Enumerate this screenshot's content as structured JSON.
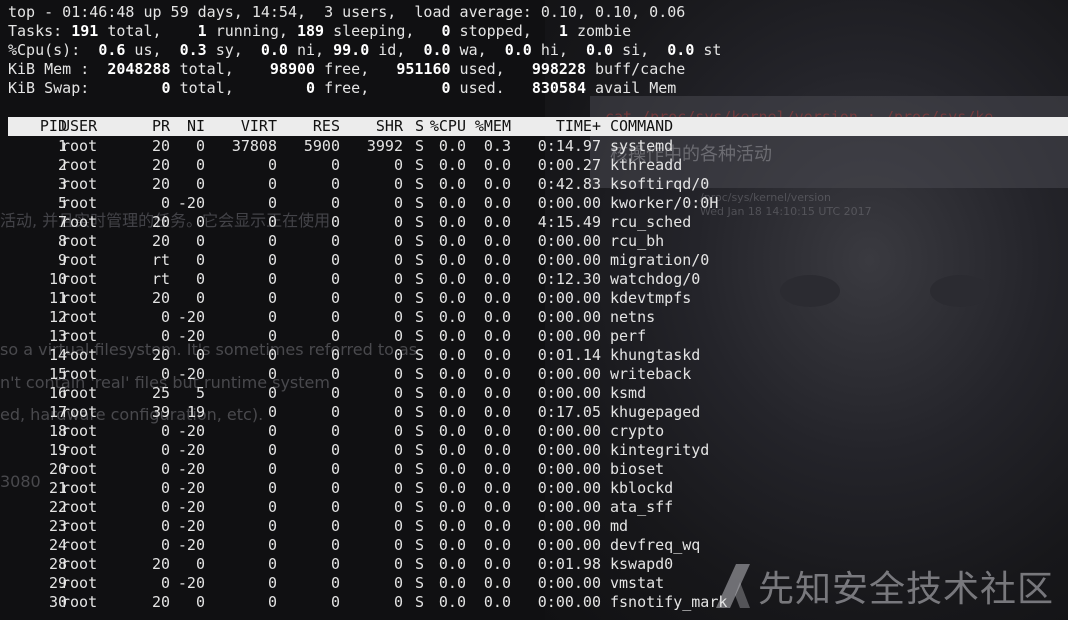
{
  "background": {
    "ghost_path1": "cat /proc/sys/kernel/version ; /proc/sys/ke",
    "ghost_heading": "核操作中的各种活动",
    "ghost_path2": "/proc/sys/kernel/version",
    "ghost_date": "Wed Jan 18 14:10:15 UTC 2017",
    "ghost_cn1": "活动, 并且实时管理的任务。它会显示正在使用",
    "ghost_en1": "so a virtual filesystem. It's sometimes referred to as",
    "ghost_en2": "n't contain 'real' files but runtime system",
    "ghost_en3": "ed, hardware configuration, etc).",
    "ghost_num": "3080"
  },
  "watermark": {
    "text": "先知安全技术社区",
    "logo_icon": "xianzhi-logo-icon"
  },
  "summary": {
    "uptime_line": "top - 01:46:48 up 59 days, 14:54,  3 users,  load average: 0.10, 0.10, 0.06",
    "tasks": {
      "label": "Tasks:",
      "total": "191",
      "running": "1",
      "sleeping": "189",
      "stopped": "0",
      "zombie": "1"
    },
    "cpu": {
      "label": "%Cpu(s):",
      "us": "0.6",
      "sy": "0.3",
      "ni": "0.0",
      "id": "99.0",
      "wa": "0.0",
      "hi": "0.0",
      "si": "0.0",
      "st": "0.0"
    },
    "mem": {
      "label": "KiB Mem :",
      "total": "2048288",
      "free": "98900",
      "used": "951160",
      "buff_cache": "998228"
    },
    "swap": {
      "label": "KiB Swap:",
      "total": "0",
      "free": "0",
      "used": "0",
      "avail_mem": "830584"
    }
  },
  "table": {
    "headers": {
      "pid": "PID",
      "user": "USER",
      "pr": "PR",
      "ni": "NI",
      "virt": "VIRT",
      "res": "RES",
      "shr": "SHR",
      "s": "S",
      "cpu": "%CPU",
      "mem": "%MEM",
      "time": "TIME+",
      "command": "COMMAND"
    },
    "rows": [
      {
        "pid": "1",
        "user": "root",
        "pr": "20",
        "ni": "0",
        "virt": "37808",
        "res": "5900",
        "shr": "3992",
        "s": "S",
        "cpu": "0.0",
        "mem": "0.3",
        "time": "0:14.97",
        "command": "systemd"
      },
      {
        "pid": "2",
        "user": "root",
        "pr": "20",
        "ni": "0",
        "virt": "0",
        "res": "0",
        "shr": "0",
        "s": "S",
        "cpu": "0.0",
        "mem": "0.0",
        "time": "0:00.27",
        "command": "kthreadd"
      },
      {
        "pid": "3",
        "user": "root",
        "pr": "20",
        "ni": "0",
        "virt": "0",
        "res": "0",
        "shr": "0",
        "s": "S",
        "cpu": "0.0",
        "mem": "0.0",
        "time": "0:42.83",
        "command": "ksoftirqd/0"
      },
      {
        "pid": "5",
        "user": "root",
        "pr": "0",
        "ni": "-20",
        "virt": "0",
        "res": "0",
        "shr": "0",
        "s": "S",
        "cpu": "0.0",
        "mem": "0.0",
        "time": "0:00.00",
        "command": "kworker/0:0H"
      },
      {
        "pid": "7",
        "user": "root",
        "pr": "20",
        "ni": "0",
        "virt": "0",
        "res": "0",
        "shr": "0",
        "s": "S",
        "cpu": "0.0",
        "mem": "0.0",
        "time": "4:15.49",
        "command": "rcu_sched"
      },
      {
        "pid": "8",
        "user": "root",
        "pr": "20",
        "ni": "0",
        "virt": "0",
        "res": "0",
        "shr": "0",
        "s": "S",
        "cpu": "0.0",
        "mem": "0.0",
        "time": "0:00.00",
        "command": "rcu_bh"
      },
      {
        "pid": "9",
        "user": "root",
        "pr": "rt",
        "ni": "0",
        "virt": "0",
        "res": "0",
        "shr": "0",
        "s": "S",
        "cpu": "0.0",
        "mem": "0.0",
        "time": "0:00.00",
        "command": "migration/0"
      },
      {
        "pid": "10",
        "user": "root",
        "pr": "rt",
        "ni": "0",
        "virt": "0",
        "res": "0",
        "shr": "0",
        "s": "S",
        "cpu": "0.0",
        "mem": "0.0",
        "time": "0:12.30",
        "command": "watchdog/0"
      },
      {
        "pid": "11",
        "user": "root",
        "pr": "20",
        "ni": "0",
        "virt": "0",
        "res": "0",
        "shr": "0",
        "s": "S",
        "cpu": "0.0",
        "mem": "0.0",
        "time": "0:00.00",
        "command": "kdevtmpfs"
      },
      {
        "pid": "12",
        "user": "root",
        "pr": "0",
        "ni": "-20",
        "virt": "0",
        "res": "0",
        "shr": "0",
        "s": "S",
        "cpu": "0.0",
        "mem": "0.0",
        "time": "0:00.00",
        "command": "netns"
      },
      {
        "pid": "13",
        "user": "root",
        "pr": "0",
        "ni": "-20",
        "virt": "0",
        "res": "0",
        "shr": "0",
        "s": "S",
        "cpu": "0.0",
        "mem": "0.0",
        "time": "0:00.00",
        "command": "perf"
      },
      {
        "pid": "14",
        "user": "root",
        "pr": "20",
        "ni": "0",
        "virt": "0",
        "res": "0",
        "shr": "0",
        "s": "S",
        "cpu": "0.0",
        "mem": "0.0",
        "time": "0:01.14",
        "command": "khungtaskd"
      },
      {
        "pid": "15",
        "user": "root",
        "pr": "0",
        "ni": "-20",
        "virt": "0",
        "res": "0",
        "shr": "0",
        "s": "S",
        "cpu": "0.0",
        "mem": "0.0",
        "time": "0:00.00",
        "command": "writeback"
      },
      {
        "pid": "16",
        "user": "root",
        "pr": "25",
        "ni": "5",
        "virt": "0",
        "res": "0",
        "shr": "0",
        "s": "S",
        "cpu": "0.0",
        "mem": "0.0",
        "time": "0:00.00",
        "command": "ksmd"
      },
      {
        "pid": "17",
        "user": "root",
        "pr": "39",
        "ni": "19",
        "virt": "0",
        "res": "0",
        "shr": "0",
        "s": "S",
        "cpu": "0.0",
        "mem": "0.0",
        "time": "0:17.05",
        "command": "khugepaged"
      },
      {
        "pid": "18",
        "user": "root",
        "pr": "0",
        "ni": "-20",
        "virt": "0",
        "res": "0",
        "shr": "0",
        "s": "S",
        "cpu": "0.0",
        "mem": "0.0",
        "time": "0:00.00",
        "command": "crypto"
      },
      {
        "pid": "19",
        "user": "root",
        "pr": "0",
        "ni": "-20",
        "virt": "0",
        "res": "0",
        "shr": "0",
        "s": "S",
        "cpu": "0.0",
        "mem": "0.0",
        "time": "0:00.00",
        "command": "kintegrityd"
      },
      {
        "pid": "20",
        "user": "root",
        "pr": "0",
        "ni": "-20",
        "virt": "0",
        "res": "0",
        "shr": "0",
        "s": "S",
        "cpu": "0.0",
        "mem": "0.0",
        "time": "0:00.00",
        "command": "bioset"
      },
      {
        "pid": "21",
        "user": "root",
        "pr": "0",
        "ni": "-20",
        "virt": "0",
        "res": "0",
        "shr": "0",
        "s": "S",
        "cpu": "0.0",
        "mem": "0.0",
        "time": "0:00.00",
        "command": "kblockd"
      },
      {
        "pid": "22",
        "user": "root",
        "pr": "0",
        "ni": "-20",
        "virt": "0",
        "res": "0",
        "shr": "0",
        "s": "S",
        "cpu": "0.0",
        "mem": "0.0",
        "time": "0:00.00",
        "command": "ata_sff"
      },
      {
        "pid": "23",
        "user": "root",
        "pr": "0",
        "ni": "-20",
        "virt": "0",
        "res": "0",
        "shr": "0",
        "s": "S",
        "cpu": "0.0",
        "mem": "0.0",
        "time": "0:00.00",
        "command": "md"
      },
      {
        "pid": "24",
        "user": "root",
        "pr": "0",
        "ni": "-20",
        "virt": "0",
        "res": "0",
        "shr": "0",
        "s": "S",
        "cpu": "0.0",
        "mem": "0.0",
        "time": "0:00.00",
        "command": "devfreq_wq"
      },
      {
        "pid": "28",
        "user": "root",
        "pr": "20",
        "ni": "0",
        "virt": "0",
        "res": "0",
        "shr": "0",
        "s": "S",
        "cpu": "0.0",
        "mem": "0.0",
        "time": "0:01.98",
        "command": "kswapd0"
      },
      {
        "pid": "29",
        "user": "root",
        "pr": "0",
        "ni": "-20",
        "virt": "0",
        "res": "0",
        "shr": "0",
        "s": "S",
        "cpu": "0.0",
        "mem": "0.0",
        "time": "0:00.00",
        "command": "vmstat"
      },
      {
        "pid": "30",
        "user": "root",
        "pr": "20",
        "ni": "0",
        "virt": "0",
        "res": "0",
        "shr": "0",
        "s": "S",
        "cpu": "0.0",
        "mem": "0.0",
        "time": "0:00.00",
        "command": "fsnotify_mark"
      }
    ]
  }
}
